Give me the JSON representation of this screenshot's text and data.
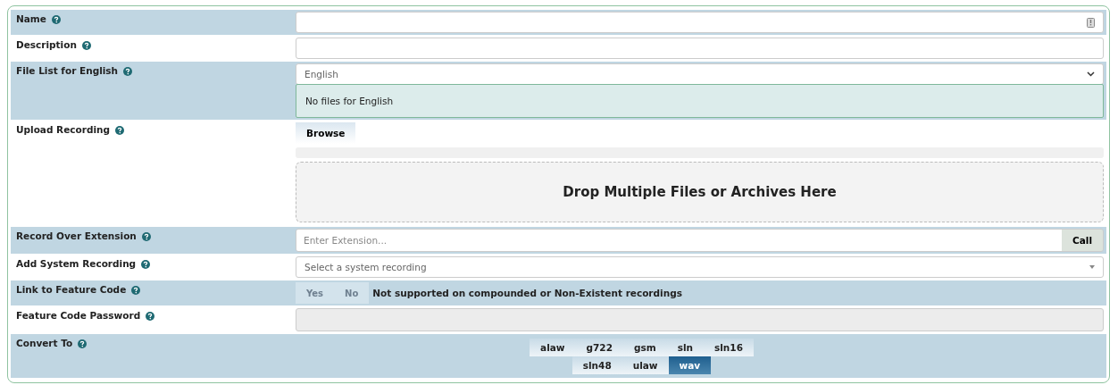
{
  "rows": [
    {
      "kind": "text",
      "label": "Name",
      "icon": true
    },
    {
      "kind": "text",
      "label": "Description"
    },
    {
      "kind": "filelist",
      "label": "File List for English",
      "select": "English",
      "message": "No files for English"
    },
    {
      "kind": "upload",
      "label": "Upload Recording",
      "button": "Browse",
      "dropzone": "Drop Multiple Files or Archives Here"
    },
    {
      "kind": "extension",
      "label": "Record Over Extension",
      "placeholder": "Enter Extension...",
      "button": "Call"
    },
    {
      "kind": "select",
      "label": "Add System Recording",
      "placeholder": "Select a system recording"
    },
    {
      "kind": "toggle",
      "label": "Link to Feature Code",
      "disabled": true,
      "options": [
        {
          "label": "Yes",
          "selected": false
        },
        {
          "label": "No",
          "selected": false
        }
      ],
      "note": "Not supported on compounded or Non-Existent recordings"
    },
    {
      "kind": "password",
      "label": "Feature Code Password",
      "disabled": true
    },
    {
      "kind": "formats",
      "label": "Convert To",
      "lines": [
        [
          {
            "label": "alaw",
            "selected": false
          },
          {
            "label": "g722",
            "selected": false
          },
          {
            "label": "gsm",
            "selected": false
          },
          {
            "label": "sln",
            "selected": false
          },
          {
            "label": "sln16",
            "selected": false
          }
        ],
        [
          {
            "label": "sln48",
            "selected": false
          },
          {
            "label": "ulaw",
            "selected": false
          },
          {
            "label": "wav",
            "selected": true
          }
        ]
      ]
    }
  ]
}
